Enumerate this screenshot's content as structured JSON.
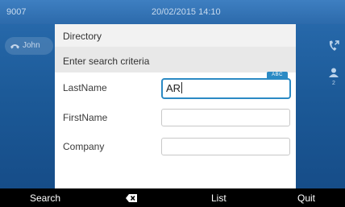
{
  "statusbar": {
    "extension": "9007",
    "datetime": "20/02/2015 14:10"
  },
  "background": {
    "line_label": "John",
    "right_badge_count": "2"
  },
  "dialog": {
    "title": "Directory",
    "criteria_prompt": "Enter search criteria",
    "input_mode_badge": "ABC",
    "fields": [
      {
        "label": "LastName",
        "value": "AR",
        "active": true
      },
      {
        "label": "FirstName",
        "value": "",
        "active": false
      },
      {
        "label": "Company",
        "value": "",
        "active": false
      }
    ]
  },
  "softkeys": {
    "search": "Search",
    "backspace_icon": "backspace-icon",
    "list": "List",
    "quit": "Quit"
  },
  "colors": {
    "accent": "#2b8ac4",
    "softkey_bar": "#000000",
    "background": "#1c5a98"
  }
}
